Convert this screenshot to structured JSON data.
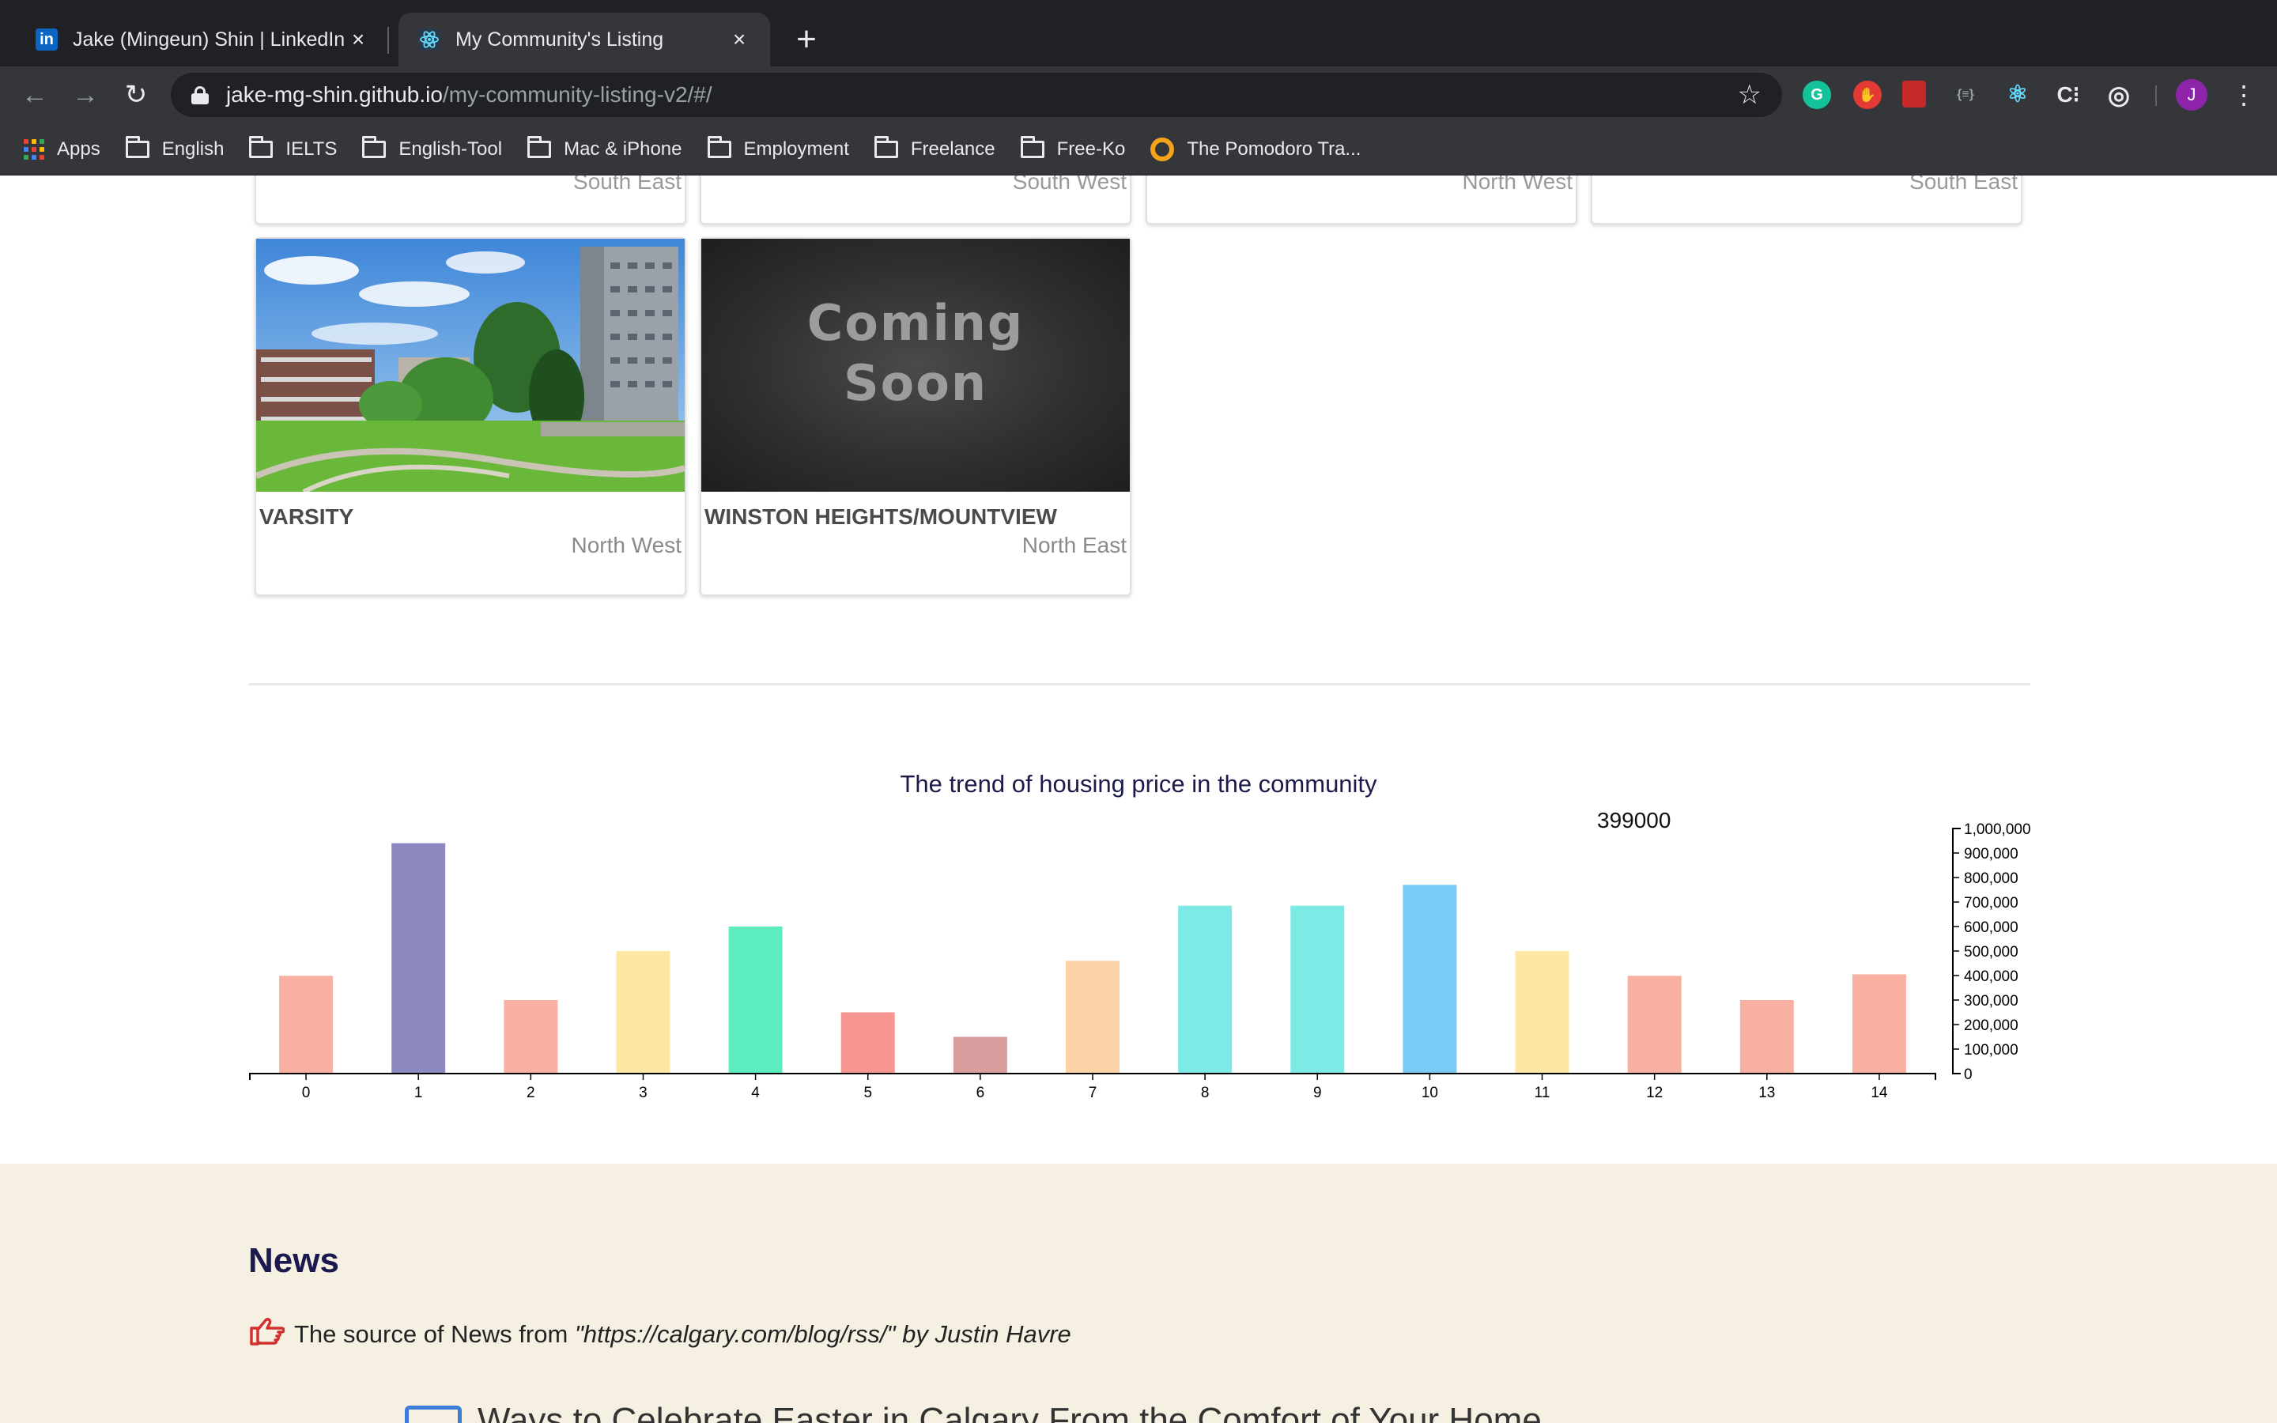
{
  "browser": {
    "tabs": [
      {
        "title": "Jake (Mingeun) Shin | LinkedIn",
        "icon": "linkedin-icon",
        "active": false
      },
      {
        "title": "My Community's Listing",
        "icon": "react-icon",
        "active": true
      }
    ],
    "url_host": "jake-mg-shin.github.io",
    "url_path": "/my-community-listing-v2/#/",
    "profile_initial": "J",
    "bookmarks": [
      {
        "label": "Apps",
        "icon": "apps-grid-icon"
      },
      {
        "label": "English",
        "icon": "folder-icon"
      },
      {
        "label": "IELTS",
        "icon": "folder-icon"
      },
      {
        "label": "English-Tool",
        "icon": "folder-icon"
      },
      {
        "label": "Mac & iPhone",
        "icon": "folder-icon"
      },
      {
        "label": "Employment",
        "icon": "folder-icon"
      },
      {
        "label": "Freelance",
        "icon": "folder-icon"
      },
      {
        "label": "Free-Ko",
        "icon": "folder-icon"
      },
      {
        "label": "The Pomodoro Tra...",
        "icon": "pomodoro-icon"
      }
    ],
    "extensions": [
      {
        "name": "grammarly-icon",
        "color": "#15c39a",
        "glyph": "G"
      },
      {
        "name": "adblock-icon",
        "color": "#e53935",
        "glyph": "✋"
      },
      {
        "name": "pdf-icon",
        "color": "#c62828",
        "glyph": "▤"
      },
      {
        "name": "brackets-icon",
        "color": "#35363a",
        "glyph": "{≡}"
      },
      {
        "name": "react-devtools-icon",
        "color": "#35363a",
        "glyph": "⚛"
      },
      {
        "name": "css-peeper-icon",
        "color": "#35363a",
        "glyph": "C⁝"
      },
      {
        "name": "target-icon",
        "color": "#35363a",
        "glyph": "◎"
      }
    ]
  },
  "listing": {
    "partial_cards": [
      {
        "region": "South East"
      },
      {
        "region": "South West"
      },
      {
        "region": "North West"
      },
      {
        "region": "South East"
      }
    ],
    "cards": [
      {
        "name": "VARSITY",
        "region": "North West",
        "image": "community-photo"
      },
      {
        "name": "WINSTON HEIGHTS/MOUNTVIEW",
        "region": "North East",
        "image": "coming-soon",
        "image_text_1": "Coming",
        "image_text_2": "Soon"
      }
    ]
  },
  "chart_title": "The trend of housing price in the community",
  "chart_tooltip": "399000",
  "chart_data": {
    "type": "bar",
    "title": "The trend of housing price in the community",
    "categories": [
      "0",
      "1",
      "2",
      "3",
      "4",
      "5",
      "6",
      "7",
      "8",
      "9",
      "10",
      "11",
      "12",
      "13",
      "14"
    ],
    "values": [
      399000,
      940000,
      300000,
      500000,
      600000,
      250000,
      150000,
      460000,
      685000,
      685000,
      770000,
      500000,
      399000,
      300000,
      405000
    ],
    "colors": [
      "#f8b1a0",
      "#8b89c0",
      "#f8b1a0",
      "#fde7a5",
      "#5decc0",
      "#f79591",
      "#d99f9f",
      "#fcd3a6",
      "#7eeae6",
      "#7eeae6",
      "#7bcbf8",
      "#fde7a5",
      "#f8b1a0",
      "#f8b1a0",
      "#f8b1a0"
    ],
    "yticks": [
      "0",
      "100,000",
      "200,000",
      "300,000",
      "400,000",
      "500,000",
      "600,000",
      "700,000",
      "800,000",
      "900,000",
      "1,000,000"
    ],
    "ylim": [
      0,
      1000000
    ],
    "y_axis_side": "right",
    "xlabel": "",
    "ylabel": ""
  },
  "news": {
    "heading": "News",
    "source_prefix": "The source of News from ",
    "source_italic": "\"https://calgary.com/blog/rss/\" by Justin Havre",
    "first_item": "Ways to Celebrate Easter in Calgary From the Comfort of Your Home"
  }
}
